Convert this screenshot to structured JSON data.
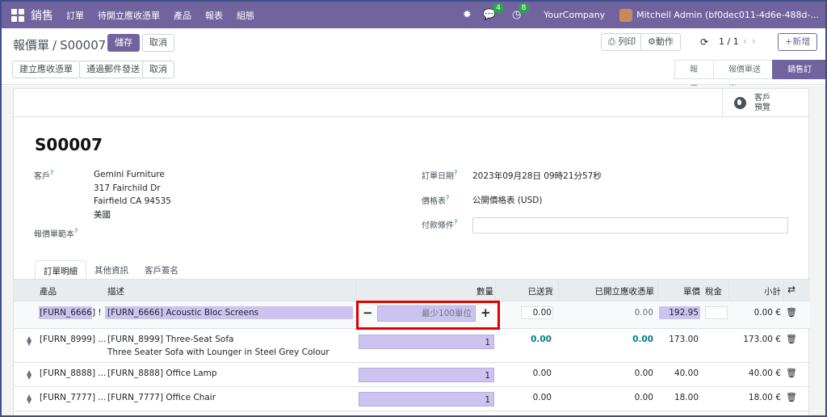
{
  "navbar": {
    "app": "銷售",
    "menus": [
      "訂單",
      "待開立應收憑單",
      "產品",
      "報表",
      "組態"
    ],
    "chat_count": "4",
    "activity_count": "8",
    "company": "YourCompany",
    "user": "Mitchell Admin (bf0dec011-4d6e-488d-..."
  },
  "breadcrumb": {
    "parent": "報價單",
    "current": "S00007"
  },
  "buttons": {
    "save": "儲存",
    "discard": "取消",
    "print": "列印",
    "action": "動作",
    "new": "新增",
    "create_invoice": "建立應收憑單",
    "send_email": "通過郵件發送",
    "cancel": "取消"
  },
  "pager": "1 / 1",
  "status": [
    "報價",
    "報價單送出",
    "銷售訂單"
  ],
  "preview": [
    "客戶",
    "預覽"
  ],
  "order": {
    "name": "S00007",
    "customer_label": "客戶",
    "customer_lines": [
      "Gemini Furniture",
      "317 Fairchild Dr",
      "Fairfield CA 94535",
      "美國"
    ],
    "template_label": "報價單範本",
    "date_label": "訂單日期",
    "date_value": "2023年09月28日 09時21分57秒",
    "pricelist_label": "價格表",
    "pricelist_value": "公開價格表 (USD)",
    "payment_label": "付款條件"
  },
  "tabs": [
    "訂單明細",
    "其他資訊",
    "客戶簽名"
  ],
  "table": {
    "headers": [
      "產品",
      "描述",
      "數量",
      "已送貨",
      "已開立應收憑單",
      "單價",
      "稅金",
      "小計"
    ],
    "rows": [
      {
        "product": "[FURN_6666] !",
        "desc": "[FURN_6666] Acoustic Bloc Screens",
        "desc2": "",
        "qty": "最少100單位",
        "delivered": "0.00",
        "invoiced": "0.00",
        "price": "192.95",
        "subtotal": "0.00 €"
      },
      {
        "product": "[FURN_8999] ...",
        "desc": "[FURN_8999] Three-Seat Sofa",
        "desc2": "Three Seater Sofa with Lounger in Steel Grey Colour",
        "qty": "1",
        "delivered": "0.00",
        "invoiced": "0.00",
        "price": "173.00",
        "subtotal": "173.00 €"
      },
      {
        "product": "[FURN_8888] ...",
        "desc": "[FURN_8888] Office Lamp",
        "desc2": "",
        "qty": "1",
        "delivered": "0.00",
        "invoiced": "0.00",
        "price": "40.00",
        "subtotal": "40.00 €"
      },
      {
        "product": "[FURN_7777] ...",
        "desc": "[FURN_7777] Office Chair",
        "desc2": "",
        "qty": "1",
        "delivered": "0.00",
        "invoiced": "0.00",
        "price": "18.00",
        "subtotal": "18.00 €"
      }
    ]
  }
}
